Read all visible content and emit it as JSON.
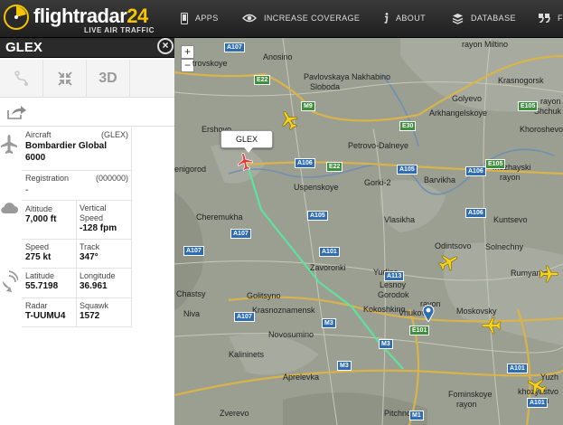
{
  "header": {
    "logo_name_prefix": "flightradar",
    "logo_name_number": "24",
    "logo_tagline": "LIVE AIR TRAFFIC",
    "nav": [
      {
        "label": "APPS",
        "icon": "phone-icon"
      },
      {
        "label": "INCREASE COVERAGE",
        "icon": "eye-icon"
      },
      {
        "label": "ABOUT",
        "icon": "info-icon"
      },
      {
        "label": "DATABASE",
        "icon": "database-icon"
      },
      {
        "label": "F",
        "icon": "quote-icon"
      }
    ]
  },
  "flight": {
    "callsign": "GLEX",
    "close_label": "×",
    "tool_3d": "3D",
    "aircraft_label": "Aircraft",
    "aircraft_code": "(GLEX)",
    "aircraft_name": "Bombardier Global 6000",
    "registration_label": "Registration",
    "registration_code": "(000000)",
    "registration_value": "-",
    "altitude_label": "Altitude",
    "altitude_value": "7,000 ft",
    "vspeed_label": "Vertical Speed",
    "vspeed_value": "-128 fpm",
    "speed_label": "Speed",
    "speed_value": "275 kt",
    "track_label": "Track",
    "track_value": "347°",
    "lat_label": "Latitude",
    "lat_value": "55.7198",
    "lon_label": "Longitude",
    "lon_value": "36.961",
    "radar_label": "Radar",
    "radar_value": "T-UUMU4",
    "squawk_label": "Squawk",
    "squawk_value": "1572"
  },
  "map": {
    "zoom_in": "+",
    "zoom_out": "−",
    "aircraft_label": "GLEX",
    "places": [
      "rayon Miltino",
      "Nakhabino",
      "Krasnogorsk",
      "Anosino",
      "Pavlovskaya",
      "Sloboda",
      "Golyevo",
      "Arkhangelskoye",
      "rayon",
      "Shchuk",
      "Khoroshevo-",
      "trovskoye",
      "Ershovo",
      "Petrovo-Dalneye",
      "enigorod",
      "Gorki-2",
      "Mozhayski",
      "rayon",
      "Uspenskoye",
      "Barvikha",
      "Cheremukha",
      "Vlasikha",
      "Kuntsevo",
      "Odintsovo",
      "Yudino",
      "Solnechny",
      "Lesnoy",
      "Gorodok",
      "Zavoronki",
      "Rumyantse",
      "Chastsy",
      "Golitsyno",
      "Niva",
      "Krasnoznamensk",
      "Kokoshkino",
      "rayon",
      "Vnukovo",
      "Moskovsky",
      "Novosumino",
      "Kalininets",
      "Aprelevka",
      "Fominskoye",
      "rayon",
      "Zverevo",
      "Pitchnoy",
      "Yuzh",
      "khozyastvo",
      "rayon"
    ],
    "roads": [
      "A107",
      "E22",
      "M9",
      "E30",
      "E105",
      "A106",
      "E22",
      "A105",
      "A106",
      "E105",
      "A107",
      "A105",
      "A106",
      "A107",
      "M3",
      "A113",
      "A101",
      "M3",
      "M3",
      "E101",
      "A101",
      "A101",
      "A107",
      "M1"
    ]
  },
  "colors": {
    "accent_yellow": "#f5c400",
    "track_green": "#5de39d",
    "map_bg": "#9b9f92"
  }
}
